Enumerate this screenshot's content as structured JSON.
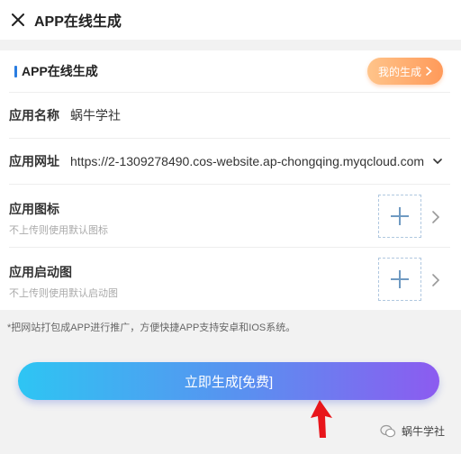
{
  "header": {
    "title": "APP在线生成"
  },
  "section": {
    "title": "APP在线生成",
    "my_gen_label": "我的生成"
  },
  "form": {
    "app_name_label": "应用名称",
    "app_name_value": "蜗牛学社",
    "app_url_label": "应用网址",
    "app_url_value": "https://2-1309278490.cos-website.ap-chongqing.myqcloud.com",
    "app_icon_label": "应用图标",
    "app_icon_hint": "不上传则使用默认图标",
    "splash_label": "应用启动图",
    "splash_hint": "不上传则使用默认启动图"
  },
  "note": "*把网站打包成APP进行推广，方便快捷APP支持安卓和IOS系统。",
  "generate_button": "立即生成[免费]",
  "watermark": "蜗牛学社",
  "colors": {
    "accent": "#2a7de1",
    "orange": "#ff9a5a",
    "gradient_start": "#2ec5f3",
    "gradient_end": "#8c5bf0",
    "annotation_red": "#e8151b"
  }
}
